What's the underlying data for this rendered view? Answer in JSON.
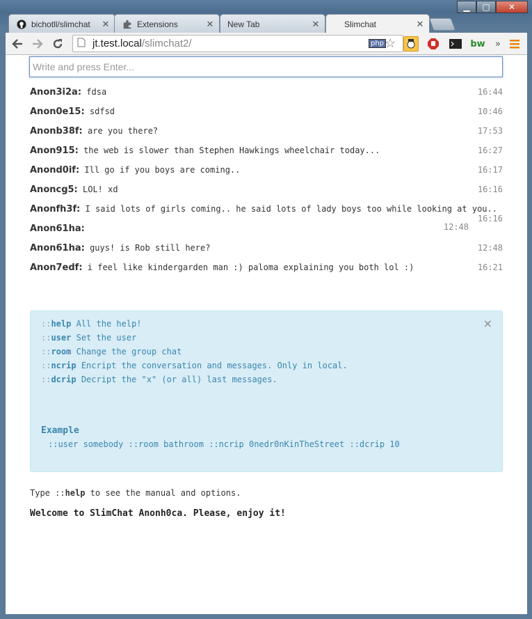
{
  "window": {
    "minimize": "▁",
    "maximize": "▢",
    "close": "✕"
  },
  "tabs": [
    {
      "title": "bichotll/slimchat",
      "icon": "github-icon"
    },
    {
      "title": "Extensions",
      "icon": "puzzle-icon"
    },
    {
      "title": "New Tab",
      "icon": ""
    },
    {
      "title": "Slimchat",
      "icon": ""
    }
  ],
  "toolbar": {
    "url_host": "jt.test.local",
    "url_path": "/slimchat2/",
    "php_badge": "php",
    "overflow": "»"
  },
  "chat": {
    "input_placeholder": "Write and press Enter...",
    "messages": [
      {
        "user": "Anon3i2a:",
        "text": "fdsa",
        "time": "16:44"
      },
      {
        "user": "Anon0e15:",
        "text": "sdfsd",
        "time": "10:46"
      },
      {
        "user": "Anonb38f:",
        "text": "are you there?",
        "time": "17:53"
      },
      {
        "user": "Anon915:",
        "text": "the web is slower than Stephen Hawkings wheelchair today...",
        "time": "16:27"
      },
      {
        "user": "Anond0if:",
        "text": "Ill go if you boys are coming..",
        "time": "16:17"
      },
      {
        "user": "Anoncg5:",
        "text": "LOL! xd",
        "time": "16:16"
      },
      {
        "user": "Anonfh3f:",
        "text": "I said lots of girls coming.. he said lots of lady boys too while looking at you..",
        "time": "16:16"
      },
      {
        "user": "Anon61ha:",
        "text": "",
        "time": "12:48"
      },
      {
        "user": "Anon61ha:",
        "text": "guys! is Rob still here?",
        "time": "12:48"
      },
      {
        "user": "Anon7edf:",
        "text": "i feel like kindergarden man :) paloma explaining you both lol :)",
        "time": "16:21"
      }
    ]
  },
  "help": {
    "close": "×",
    "commands": [
      {
        "prefix": "::",
        "name": "help",
        "desc": "All the help!"
      },
      {
        "prefix": "::",
        "name": "user",
        "desc": "Set the user"
      },
      {
        "prefix": "::",
        "name": "room",
        "desc": "Change the group chat"
      },
      {
        "prefix": "::",
        "name": "ncrip",
        "desc": "Encript the conversation and messages. Only in local."
      },
      {
        "prefix": "::",
        "name": "dcrip",
        "desc": "Decript the \"x\" (or all) last messages."
      }
    ],
    "example_title": "Example",
    "example_text": "::user somebody ::room bathroom ::ncrip 0nedr0nKinTheStreet ::dcrip 10"
  },
  "hint": {
    "before": "Type ",
    "cmd_prefix": "::",
    "cmd": "help",
    "after": " to see the manual and options."
  },
  "welcome": "Welcome to SlimChat Anonh0ca. Please, enjoy it!"
}
